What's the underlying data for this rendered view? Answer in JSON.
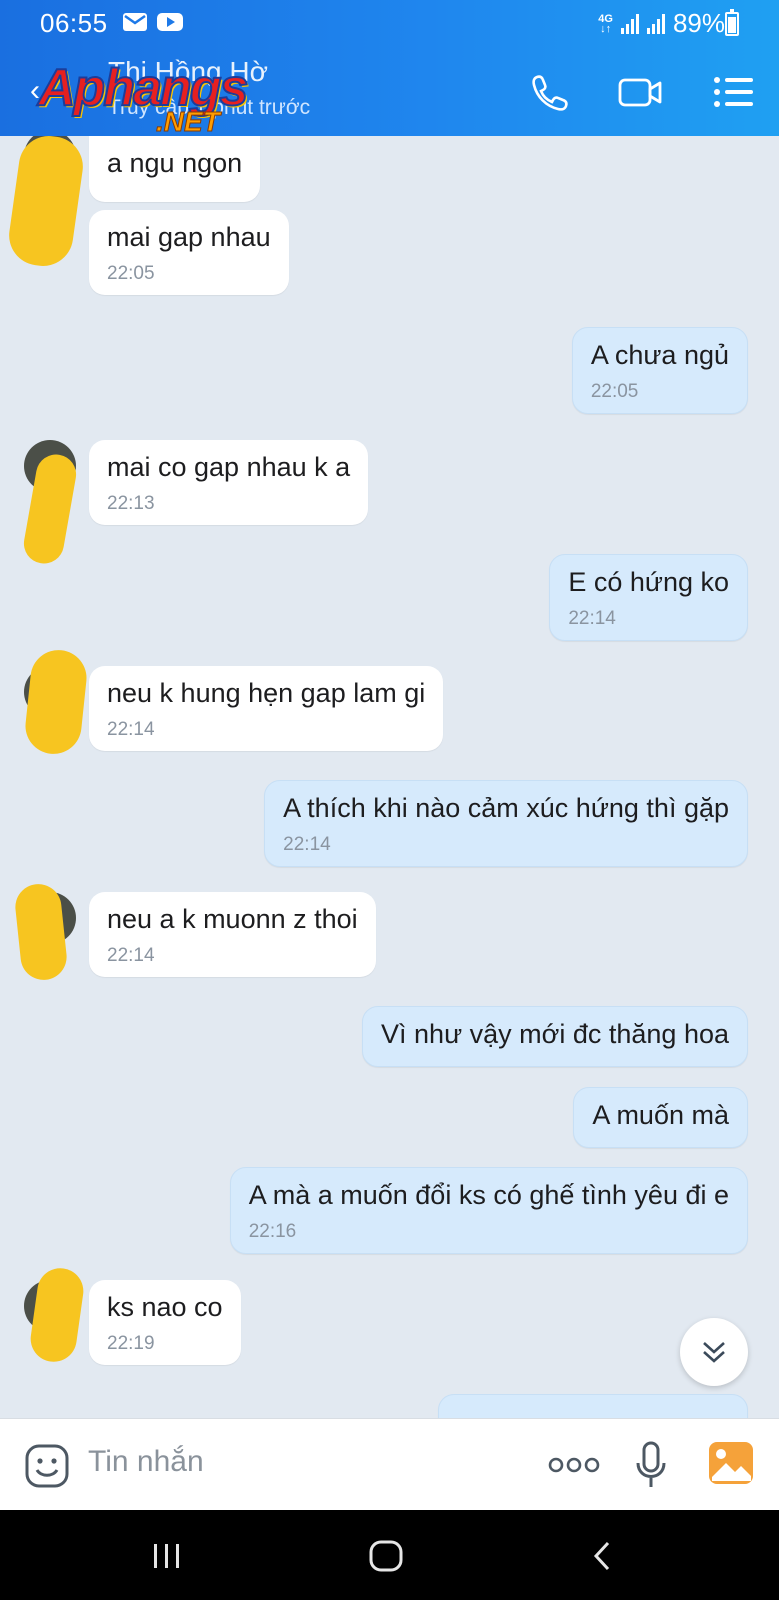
{
  "status_bar": {
    "time": "06:55",
    "network_tag": "4G",
    "battery": "89%",
    "battery_level": 0.89
  },
  "header": {
    "contact_name": "Thi Hồng Hờ",
    "subtitle": "Truy cập 1 phút trước",
    "watermark_text": "Aphangs",
    "watermark_sub": ".NET",
    "icons": [
      "back-icon",
      "phone-icon",
      "video-call-icon",
      "menu-icon"
    ]
  },
  "messages": [
    {
      "side": "in",
      "text": "a ngu ngon",
      "time": ""
    },
    {
      "side": "in",
      "text": " mai gap nhau",
      "time": "22:05"
    },
    {
      "side": "out",
      "text": "A chưa ngủ",
      "time": "22:05"
    },
    {
      "side": "in",
      "text": "mai co gap nhau k a",
      "time": "22:13"
    },
    {
      "side": "out",
      "text": "E có hứng ko",
      "time": "22:14"
    },
    {
      "side": "in",
      "text": " neu k hung hẹn gap lam gi",
      "time": "22:14"
    },
    {
      "side": "out",
      "text": "A thích khi nào cảm xúc hứng thì gặp",
      "time": "22:14"
    },
    {
      "side": "in",
      "text": "neu a k muonn z thoi",
      "time": "22:14"
    },
    {
      "side": "out",
      "text": "Vì như vậy mới đc thăng hoa",
      "time": ""
    },
    {
      "side": "out",
      "text": "A muốn mà",
      "time": ""
    },
    {
      "side": "out",
      "text": "A mà a muốn đổi ks có ghế tình yêu đi e",
      "time": "22:16"
    },
    {
      "side": "in",
      "text": " ks nao co",
      "time": "22:19"
    }
  ],
  "composer": {
    "placeholder": "Tin nhắn",
    "icons": [
      "emoji-icon",
      "more-icon",
      "microphone-icon",
      "gallery-icon"
    ]
  },
  "colors": {
    "header_gradient_start": "#1a6fe0",
    "header_gradient_end": "#1fa0f2",
    "chat_background": "#e2e9f1",
    "incoming_bubble": "#ffffff",
    "outgoing_bubble": "#d6eafc",
    "gallery_icon": "#f5a23a"
  }
}
